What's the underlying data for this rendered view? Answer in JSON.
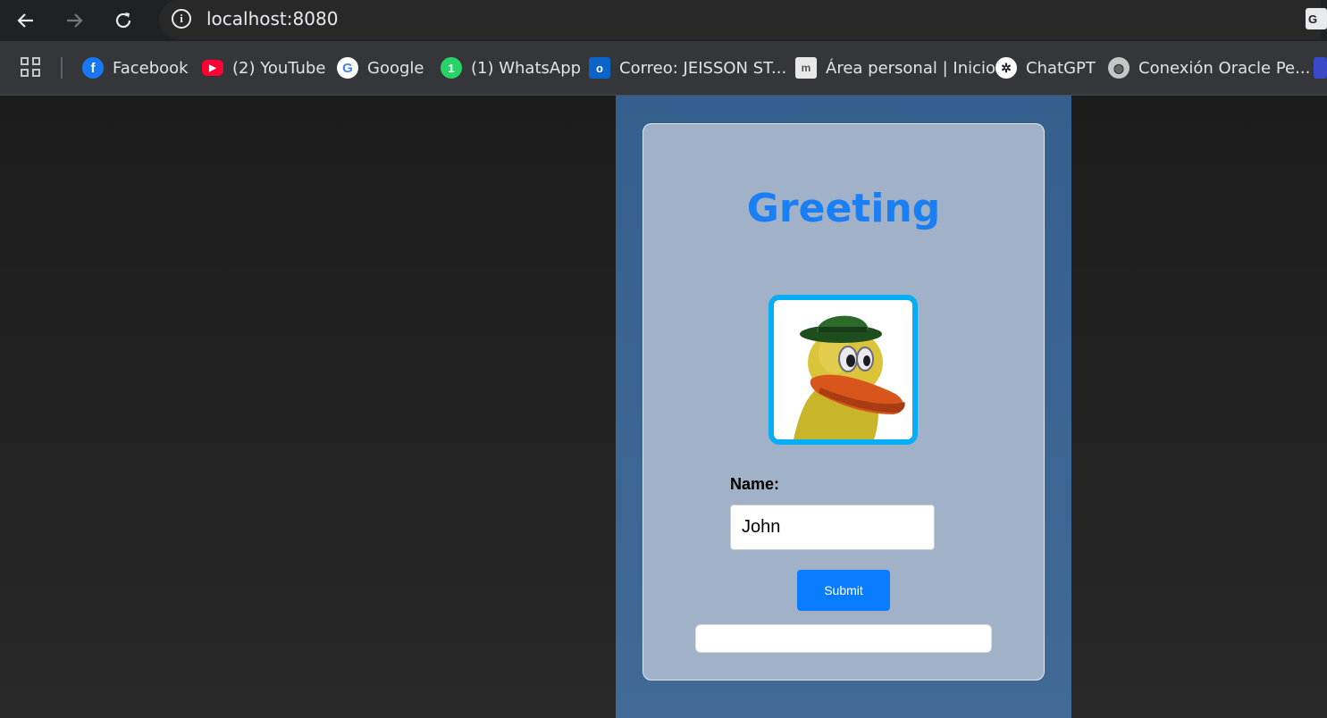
{
  "browser": {
    "url": "localhost:8080",
    "bookmarks": [
      {
        "label": "Facebook",
        "icon": "facebook-icon",
        "color": "#1877f2"
      },
      {
        "label": "(2) YouTube",
        "icon": "youtube-icon",
        "color": "#ff0033"
      },
      {
        "label": "Google",
        "icon": "google-icon",
        "color": "#ffffff"
      },
      {
        "label": "(1) WhatsApp",
        "icon": "whatsapp-icon",
        "color": "#25d366"
      },
      {
        "label": "Correo: JEISSON ST...",
        "icon": "outlook-icon",
        "color": "#0a64c8"
      },
      {
        "label": "Área personal | Inicio",
        "icon": "moodle-icon",
        "color": "#e8e8e8"
      },
      {
        "label": "ChatGPT",
        "icon": "chatgpt-icon",
        "color": "#ffffff"
      },
      {
        "label": "Conexión Oracle Pe...",
        "icon": "globe-icon",
        "color": "#c4c7c5"
      }
    ]
  },
  "app": {
    "title": "Greeting",
    "name_label": "Name:",
    "name_value": "John",
    "submit_label": "Submit",
    "output_text": "",
    "colors": {
      "title": "#1a7ff2",
      "avatar_border": "#08aef5",
      "button": "#0a7cff",
      "card": "#a0b1c8",
      "panel": "#3c6591"
    }
  }
}
